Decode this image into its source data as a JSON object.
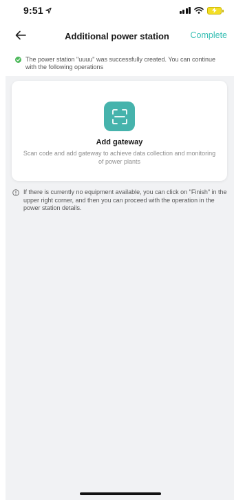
{
  "status_bar": {
    "time": "9:51",
    "location_icon": "location-arrow-icon",
    "signal_icon": "cellular-signal-icon",
    "wifi_icon": "wifi-icon",
    "battery_icon": "battery-charging-icon"
  },
  "nav": {
    "title": "Additional power station",
    "complete_label": "Complete",
    "back_icon": "back-arrow-icon"
  },
  "success": {
    "message": "The power station \"uuuu\" was successfully created. You can continue with the following operations",
    "icon": "success-check-icon"
  },
  "card": {
    "title": "Add gateway",
    "description": "Scan code and add gateway to achieve data collection and monitoring of power plants",
    "icon": "scan-icon"
  },
  "tip": {
    "text": "If there is currently no equipment available, you can click on \"Finish\" in the upper right corner, and then you can proceed with the operation in the power station details.",
    "icon": "info-circle-icon"
  },
  "colors": {
    "accent": "#3bc0b5",
    "icon_bg": "#46b3ac",
    "success": "#4cb85a",
    "content_bg": "#f1f2f4"
  }
}
